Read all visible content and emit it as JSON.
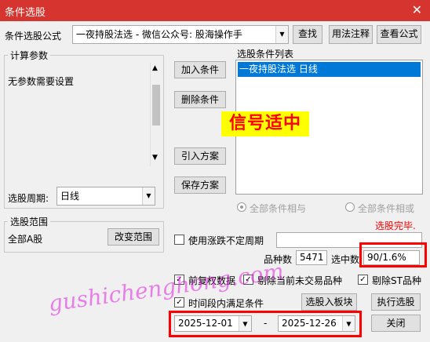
{
  "window": {
    "title": "条件选股",
    "close_glyph": "✕"
  },
  "formula": {
    "label": "条件选股公式",
    "value": "一夜持股法选  -  微信公众号: 股海操作手",
    "find_button": "查找",
    "usage_button": "用法注释",
    "view_button": "查看公式"
  },
  "params": {
    "group_title": "计算参数",
    "text": "无参数需要设置",
    "period_label": "选股周期:",
    "period_value": "日线"
  },
  "actions": {
    "add": "加入条件",
    "delete": "删除条件",
    "import": "引入方案",
    "save": "保存方案"
  },
  "condition_list": {
    "title": "选股条件列表",
    "items": [
      "一夜持股法选  日线"
    ],
    "overlay_text": "信号适中"
  },
  "logic": {
    "and_label": "全部条件相与",
    "or_label": "全部条件相或",
    "status": "选股完毕."
  },
  "range": {
    "group_title": "选股范围",
    "value": "全部A股",
    "change_button": "改变范围"
  },
  "options": {
    "irregular_period": "使用涨跌不定周期",
    "count_label": "品种数",
    "count_value": "5471",
    "selected_label": "选中数",
    "selected_value": "90/1.6%",
    "forward_adjust": "前复权数据",
    "exclude_untraded": "剔除当前未交易品种",
    "exclude_st": "剔除ST品种",
    "time_range": "时间段内满足条件",
    "to_block_button": "选股入板块",
    "run_button": "执行选股",
    "date_from": "2025-12-01",
    "date_sep": "-",
    "date_to": "2025-12-26",
    "close_button": "关闭"
  },
  "watermark": "gushichenghong.com",
  "colors": {
    "titlebar": "#d6342e",
    "selection": "#0078d7",
    "highlight_box": "#ff0000",
    "overlay_bg": "#ffff00"
  }
}
